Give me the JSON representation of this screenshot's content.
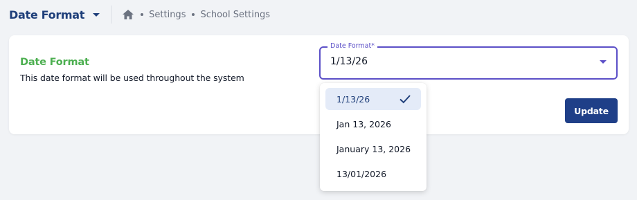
{
  "header": {
    "title": "Date Format",
    "breadcrumb": [
      "Settings",
      "School Settings"
    ]
  },
  "card": {
    "section_title": "Date Format",
    "section_description": "This date format will be used throughout the system",
    "select": {
      "label": "Date Format*",
      "value": "1/13/26"
    },
    "update_label": "Update"
  },
  "dropdown": {
    "options": [
      "1/13/26",
      "Jan 13, 2026",
      "January 13, 2026",
      "13/01/2026"
    ],
    "selected_index": 0
  },
  "colors": {
    "brand": "#1f3f7a",
    "accent": "#5b4fc7",
    "section_title": "#4caf50",
    "button": "#1f3f88"
  },
  "icons": [
    "chevron-down-icon",
    "home-icon",
    "check-icon"
  ]
}
